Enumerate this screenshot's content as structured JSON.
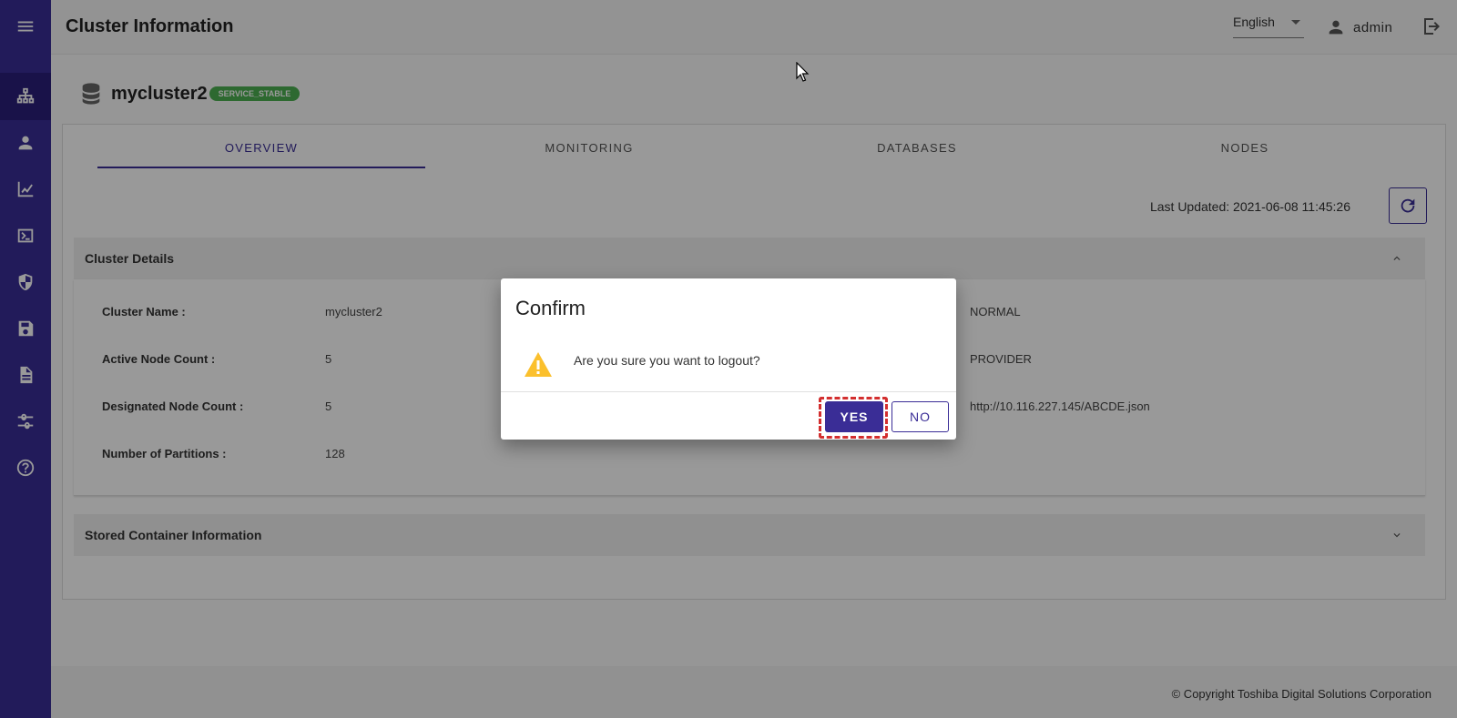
{
  "header": {
    "title": "Cluster Information",
    "language": "English",
    "username": "admin"
  },
  "sidebar": {
    "items": [
      {
        "icon": "menu-icon"
      },
      {
        "icon": "cluster-icon",
        "active": true
      },
      {
        "icon": "user-icon"
      },
      {
        "icon": "chart-icon"
      },
      {
        "icon": "terminal-icon"
      },
      {
        "icon": "shield-icon"
      },
      {
        "icon": "save-icon"
      },
      {
        "icon": "document-icon"
      },
      {
        "icon": "settings-sliders-icon"
      },
      {
        "icon": "help-icon"
      }
    ]
  },
  "cluster": {
    "name": "mycluster2",
    "status": "SERVICE_STABLE"
  },
  "tabs": [
    {
      "label": "OVERVIEW",
      "active": true
    },
    {
      "label": "MONITORING"
    },
    {
      "label": "DATABASES"
    },
    {
      "label": "NODES"
    }
  ],
  "last_updated": "Last Updated: 2021-06-08 11:45:26",
  "cluster_details": {
    "title": "Cluster Details",
    "rows": [
      {
        "label": "Cluster Name :",
        "value": "mycluster2",
        "right_value": "NORMAL"
      },
      {
        "label": "Active Node Count :",
        "value": "5",
        "right_value": "PROVIDER"
      },
      {
        "label": "Designated Node Count :",
        "value": "5",
        "right_value": "http://10.116.227.145/ABCDE.json"
      },
      {
        "label": "Number of Partitions :",
        "value": "128",
        "right_value": ""
      }
    ]
  },
  "stored_container": {
    "title": "Stored Container Information"
  },
  "footer": {
    "copyright": "© Copyright Toshiba Digital Solutions Corporation"
  },
  "dialog": {
    "title": "Confirm",
    "message": "Are you sure you want to logout?",
    "yes_label": "YES",
    "no_label": "NO"
  },
  "colors": {
    "primary": "#3a2d96",
    "badge": "#4caf50",
    "warning": "#fbc02d",
    "focus": "#d32f2f"
  }
}
